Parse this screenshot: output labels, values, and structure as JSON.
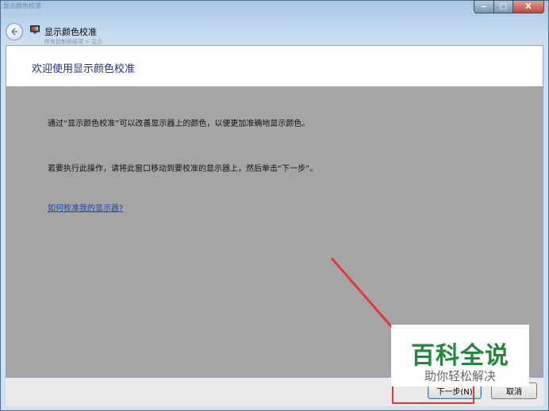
{
  "window": {
    "faint_title": "显示颜色校准",
    "faint_subtitle": "所有控制面板项 > 显示",
    "title": "显示颜色校准",
    "controls": {
      "minimize": "‒",
      "maximize": "□",
      "close": "X"
    }
  },
  "page": {
    "heading": "欢迎使用显示颜色校准",
    "paragraph1": "通过“显示颜色校准”可以改善显示器上的颜色，以便更加准确地显示颜色。",
    "paragraph2": "若要执行此操作，请将此窗口移动到要校准的显示器上，然后单击“下一步”。",
    "help_link": "如何校准我的显示器?"
  },
  "footer": {
    "next_label": "下一步(N)",
    "cancel_label": "取消"
  },
  "watermark": {
    "main": "百科全说",
    "sub": "助你轻松解决"
  },
  "colors": {
    "heading": "#1e3287",
    "link": "#1748b8",
    "annotation": "#e53935",
    "watermark": "#1f8a3a"
  }
}
